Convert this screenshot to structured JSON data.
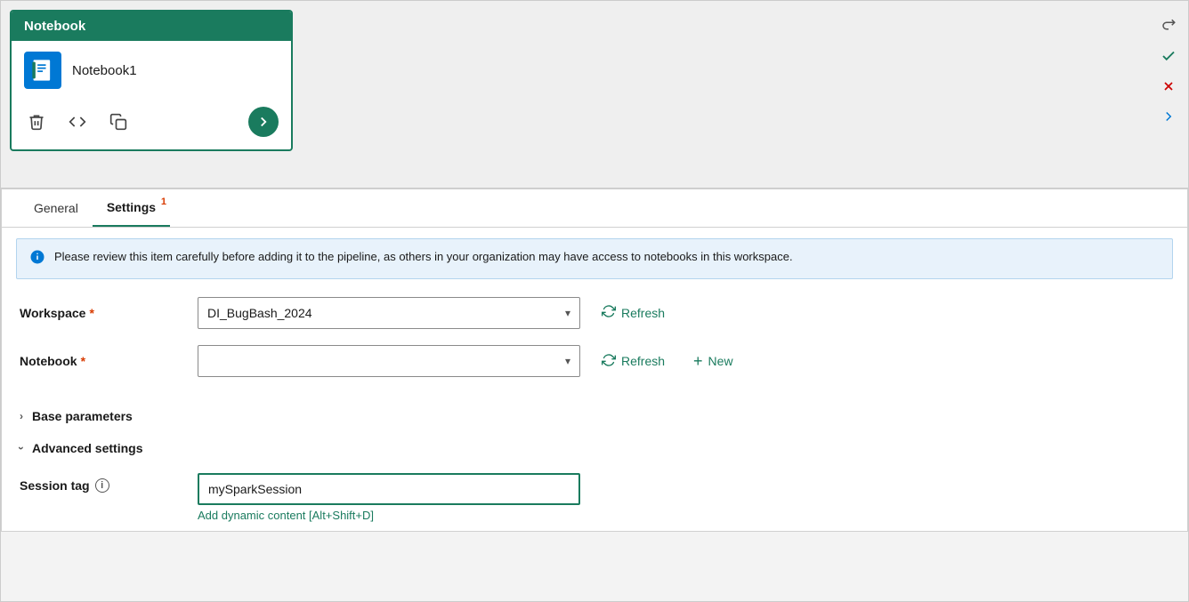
{
  "card": {
    "title": "Notebook",
    "name": "Notebook1"
  },
  "toolbar": {
    "icons": [
      "↩",
      "✓",
      "✕",
      "→"
    ]
  },
  "tabs": [
    {
      "id": "general",
      "label": "General",
      "active": false,
      "badge": null
    },
    {
      "id": "settings",
      "label": "Settings",
      "active": true,
      "badge": "1"
    }
  ],
  "info_bar": {
    "message": "Please review this item carefully before adding it to the pipeline, as others in your organization may have access to notebooks in this workspace."
  },
  "form": {
    "workspace": {
      "label": "Workspace",
      "required": true,
      "value": "DI_BugBash_2024",
      "refresh_label": "Refresh"
    },
    "notebook": {
      "label": "Notebook",
      "required": true,
      "value": "",
      "refresh_label": "Refresh",
      "new_label": "New"
    }
  },
  "sections": {
    "base_parameters": {
      "label": "Base parameters",
      "expanded": false
    },
    "advanced_settings": {
      "label": "Advanced settings",
      "expanded": true
    }
  },
  "session_tag": {
    "label": "Session tag",
    "value": "mySparkSession",
    "dynamic_content_link": "Add dynamic content [Alt+Shift+D]"
  },
  "colors": {
    "teal": "#1a7b5e",
    "required_red": "#d83b01",
    "info_blue": "#0078d4"
  }
}
